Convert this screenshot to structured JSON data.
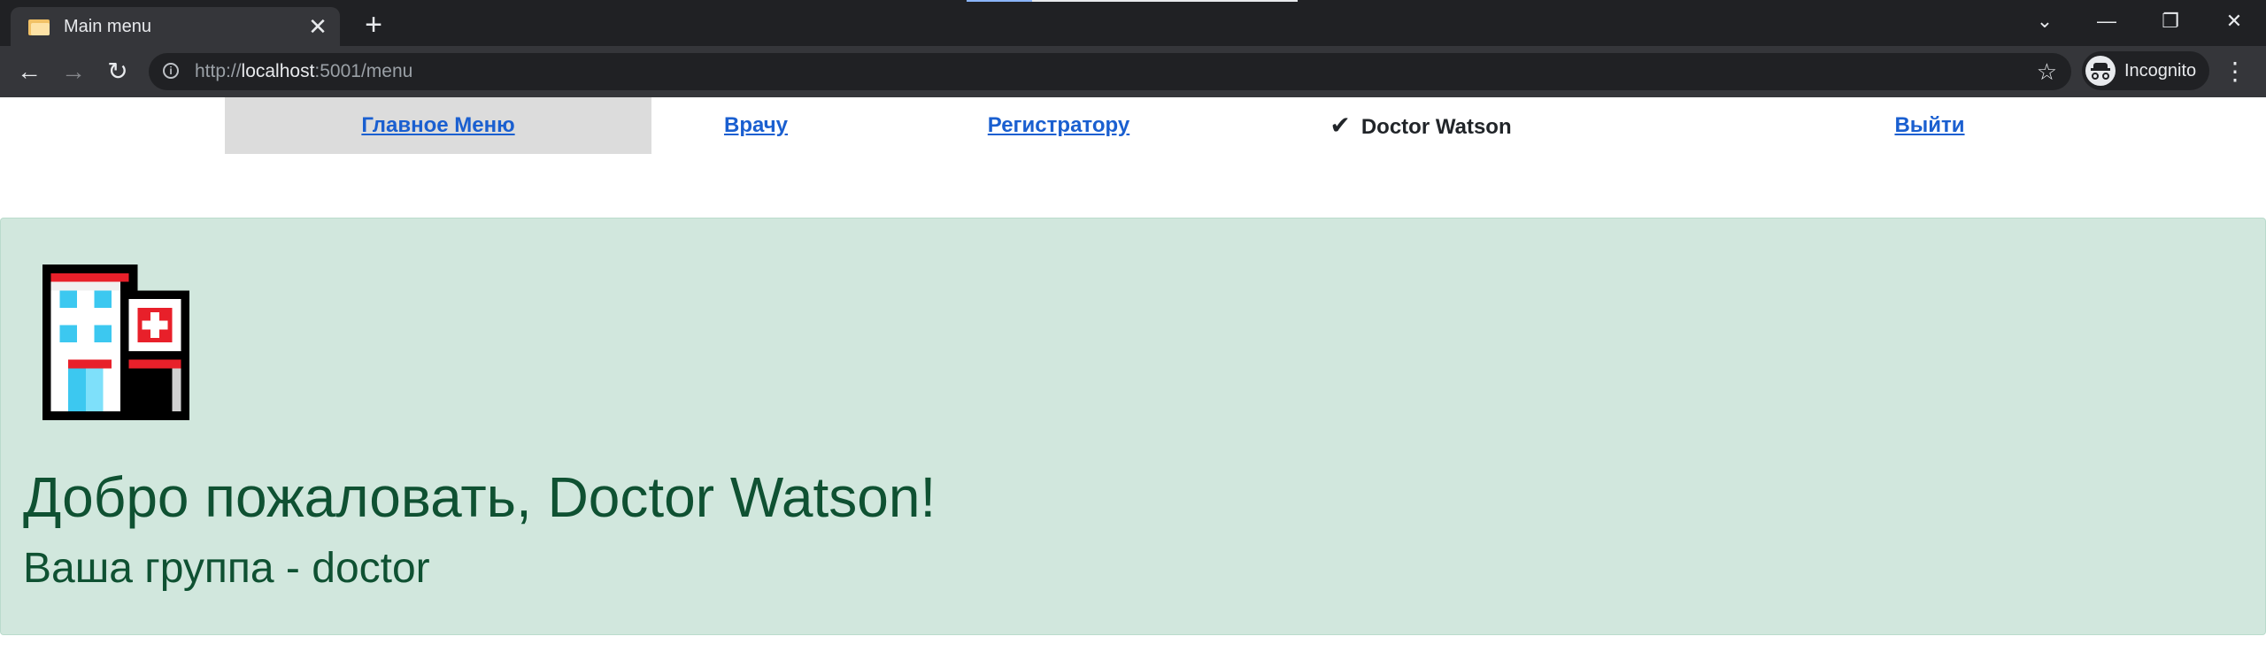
{
  "browser": {
    "tab_title": "Main menu",
    "tab_close": "✕",
    "new_tab": "+",
    "url_scheme": "http://",
    "url_host": "localhost",
    "url_rest": ":5001/menu",
    "profile_label": "Incognito",
    "icons": {
      "favicon": "folder-icon",
      "back": "arrow-left-icon",
      "forward": "arrow-right-icon",
      "reload": "reload-icon",
      "info": "info-icon",
      "bookmark": "star-icon",
      "menu": "kebab-menu-icon"
    }
  },
  "nav": {
    "main_menu": "Главное Меню",
    "doctor": "Врачу",
    "registrar": "Регистратору",
    "user": "Doctor Watson",
    "logout": "Выйти"
  },
  "welcome": {
    "title": "Добро пожаловать, Doctor Watson!",
    "group": "Ваша группа - doctor"
  },
  "colors": {
    "link": "#1a5fd0",
    "alert_bg": "#d1e7dd",
    "alert_text": "#0f5132",
    "active_nav_bg": "#dcdcdc"
  }
}
